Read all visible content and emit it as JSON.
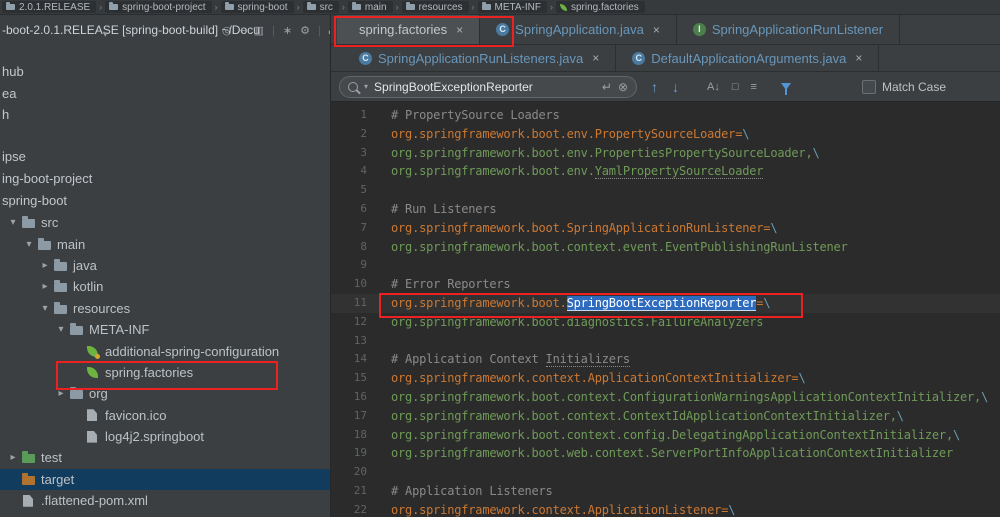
{
  "colors": {
    "annotation_red": "#ec2121",
    "key_orange": "#cc7832",
    "value_green": "#6f9a58",
    "comment_gray": "#8a8a8a",
    "selection_blue": "#2d6bbf",
    "spring_green": "#6db33f",
    "modified_file_blue": "#6897bb"
  },
  "breadcrumb": {
    "separator": "›",
    "items": [
      "2.0.1.RELEASE",
      "spring-boot-project",
      "spring-boot",
      "src",
      "main",
      "resources",
      "META-INF",
      "spring.factories"
    ]
  },
  "terminal": {
    "title": "-boot-2.0.1.RELEASE [spring-boot-build] ~/Docu",
    "lines": [
      "hub",
      "ea",
      "h",
      "ipse",
      "ing-boot-project",
      "spring-boot"
    ]
  },
  "icons": {
    "close": "×",
    "clear": "⊗",
    "chevron_down": "▾",
    "collapsed": "▸",
    "expanded": "▾",
    "up": "↑",
    "down": "↓",
    "newline": "↵",
    "class_letter": "C",
    "interface_letter": "I",
    "sort": "A↓",
    "window": "□",
    "lines": "≡",
    "toolbar": [
      "◎",
      "÷",
      "▥",
      "∗",
      "⚙",
      "▬",
      "▮"
    ]
  },
  "tabs": {
    "row1": [
      {
        "label": "spring.factories"
      },
      {
        "label": "SpringApplication.java"
      },
      {
        "label": "SpringApplicationRunListener"
      }
    ],
    "row2": [
      {
        "label": "SpringApplicationRunListeners.java"
      },
      {
        "label": "DefaultApplicationArguments.java"
      }
    ]
  },
  "search": {
    "query": "SpringBootExceptionReporter",
    "match_case_label": "Match Case",
    "match_case_checked": false
  },
  "tree": {
    "items": [
      {
        "label": "src"
      },
      {
        "label": "main"
      },
      {
        "label": "java"
      },
      {
        "label": "kotlin"
      },
      {
        "label": "resources"
      },
      {
        "label": "META-INF"
      },
      {
        "label": "additional-spring-configuration"
      },
      {
        "label": "spring.factories"
      },
      {
        "label": "org"
      },
      {
        "label": "favicon.ico"
      },
      {
        "label": "log4j2.springboot"
      },
      {
        "label": "test"
      },
      {
        "label": "target"
      },
      {
        "label": ".flattened-pom.xml"
      }
    ]
  },
  "editor": {
    "lines": [
      {
        "n": "1",
        "s": [
          {
            "t": "# PropertySource Loaders"
          }
        ]
      },
      {
        "n": "2",
        "s": [
          {
            "t": "org.springframework.boot.env.PropertySourceLoader="
          },
          {
            "t": "\\"
          }
        ]
      },
      {
        "n": "3",
        "s": [
          {
            "t": "org.springframework.boot.env.PropertiesPropertySourceLoader,"
          },
          {
            "t": "\\"
          }
        ]
      },
      {
        "n": "4",
        "s": [
          {
            "t": "org.springframework.boot.env."
          },
          {
            "t": "YamlPropertySourceLoader"
          }
        ]
      },
      {
        "n": "5",
        "s": []
      },
      {
        "n": "6",
        "s": [
          {
            "t": "# Run Listeners"
          }
        ]
      },
      {
        "n": "7",
        "s": [
          {
            "t": "org.springframework.boot.SpringApplicationRunListener="
          },
          {
            "t": "\\"
          }
        ]
      },
      {
        "n": "8",
        "s": [
          {
            "t": "org.springframework.boot.context.event.EventPublishingRunListener"
          }
        ]
      },
      {
        "n": "9",
        "s": []
      },
      {
        "n": "10",
        "s": [
          {
            "t": "# Error Reporters"
          }
        ]
      },
      {
        "n": "11",
        "s": [
          {
            "t": "org.springframework.boot."
          },
          {
            "t": "SpringBootExceptionReporter"
          },
          {
            "t": "="
          },
          {
            "t": "\\"
          }
        ]
      },
      {
        "n": "12",
        "s": [
          {
            "t": "org.springframework.boot.diagnostics.FailureAnalyzers"
          }
        ]
      },
      {
        "n": "13",
        "s": []
      },
      {
        "n": "14",
        "s": [
          {
            "t": "# Application Context "
          },
          {
            "t": "Initializers"
          }
        ]
      },
      {
        "n": "15",
        "s": [
          {
            "t": "org.springframework.context.ApplicationContextInitializer="
          },
          {
            "t": "\\"
          }
        ]
      },
      {
        "n": "16",
        "s": [
          {
            "t": "org.springframework.boot.context.ConfigurationWarningsApplicationContextInitializer,"
          },
          {
            "t": "\\"
          }
        ]
      },
      {
        "n": "17",
        "s": [
          {
            "t": "org.springframework.boot.context.ContextIdApplicationContextInitializer,"
          },
          {
            "t": "\\"
          }
        ]
      },
      {
        "n": "18",
        "s": [
          {
            "t": "org.springframework.boot.context.config.DelegatingApplicationContextInitializer,"
          },
          {
            "t": "\\"
          }
        ]
      },
      {
        "n": "19",
        "s": [
          {
            "t": "org.springframework.boot.web.context.ServerPortInfoApplicationContextInitializer"
          }
        ]
      },
      {
        "n": "20",
        "s": []
      },
      {
        "n": "21",
        "s": [
          {
            "t": "# Application Listeners"
          }
        ]
      },
      {
        "n": "22",
        "s": [
          {
            "t": "org.springframework.context.ApplicationListener="
          },
          {
            "t": "\\"
          }
        ]
      }
    ]
  }
}
